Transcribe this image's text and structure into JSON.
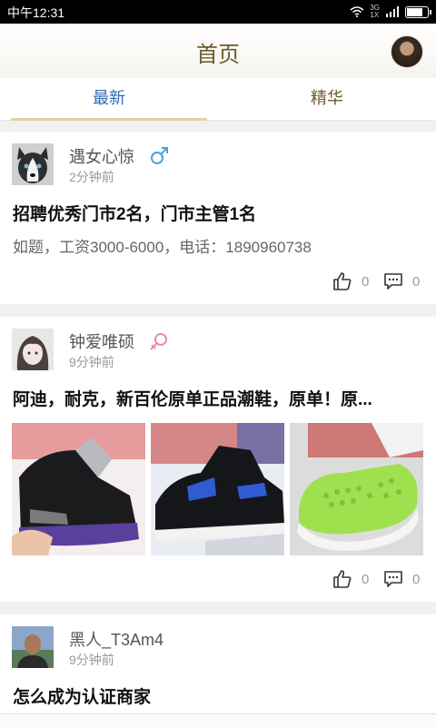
{
  "status_bar": {
    "time": "中午12:31",
    "network": "3G\n1X",
    "battery_level": 0.8
  },
  "header": {
    "title": "首页",
    "avatar_icon": "user-avatar"
  },
  "tabs": [
    {
      "label": "最新",
      "active": true
    },
    {
      "label": "精华",
      "active": false
    }
  ],
  "posts": [
    {
      "username": "遇女心惊",
      "gender": "male",
      "time": "2分钟前",
      "title": "招聘优秀门市2名，门市主管1名",
      "body": "如题，工资3000-6000，电话：1890960738",
      "likes": "0",
      "comments": "0"
    },
    {
      "username": "钟爱唯硕",
      "gender": "female",
      "time": "9分钟前",
      "title": "阿迪，耐克，新百伦原单正品潮鞋，原单！原...",
      "images": [
        "black-purple-sneaker-photo",
        "black-blue-sneaker-photo",
        "green-slipper-photo"
      ],
      "likes": "0",
      "comments": "0"
    },
    {
      "username": "黑人_T3Am4",
      "time": "9分钟前",
      "title": "怎么成为认证商家"
    }
  ],
  "colors": {
    "accent_blue": "#3469b5",
    "brand_gold": "#6b5b2c",
    "male_blue": "#4aa3d8",
    "female_pink": "#e58cb8"
  }
}
